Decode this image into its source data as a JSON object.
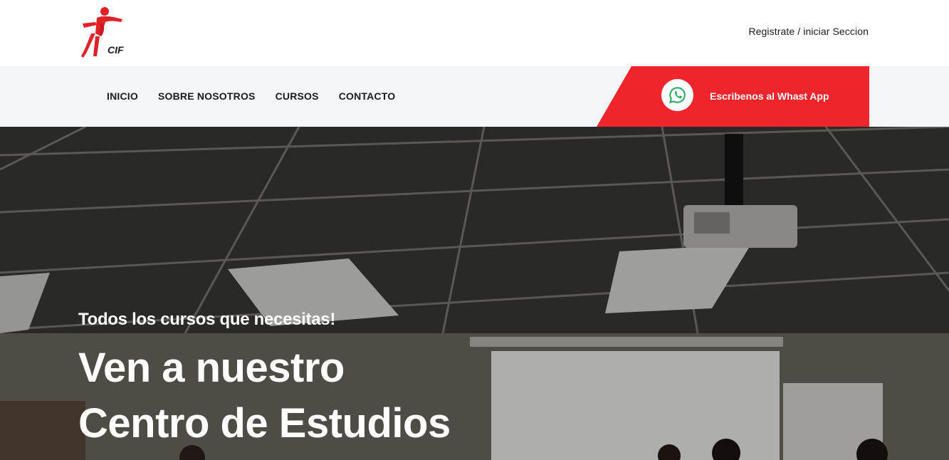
{
  "header": {
    "logo_text": "CIF",
    "login_link": "Registrate / iniciar Seccion"
  },
  "nav": {
    "items": [
      {
        "label": "INICIO"
      },
      {
        "label": "SOBRE NOSOTROS"
      },
      {
        "label": "CURSOS"
      },
      {
        "label": "CONTACTO"
      }
    ]
  },
  "whatsapp": {
    "label": "Escribenos al Whast App",
    "icon": "whatsapp-icon"
  },
  "hero": {
    "subtitle": "Todos los cursos que necesitas!",
    "title_line1": "Ven a nuestro",
    "title_line2": "Centro de Estudios"
  },
  "colors": {
    "accent": "#f0252b",
    "nav_bg": "#f4f5f9",
    "whatsapp_green": "#25a85a",
    "text_dark": "#1b1b1b"
  }
}
